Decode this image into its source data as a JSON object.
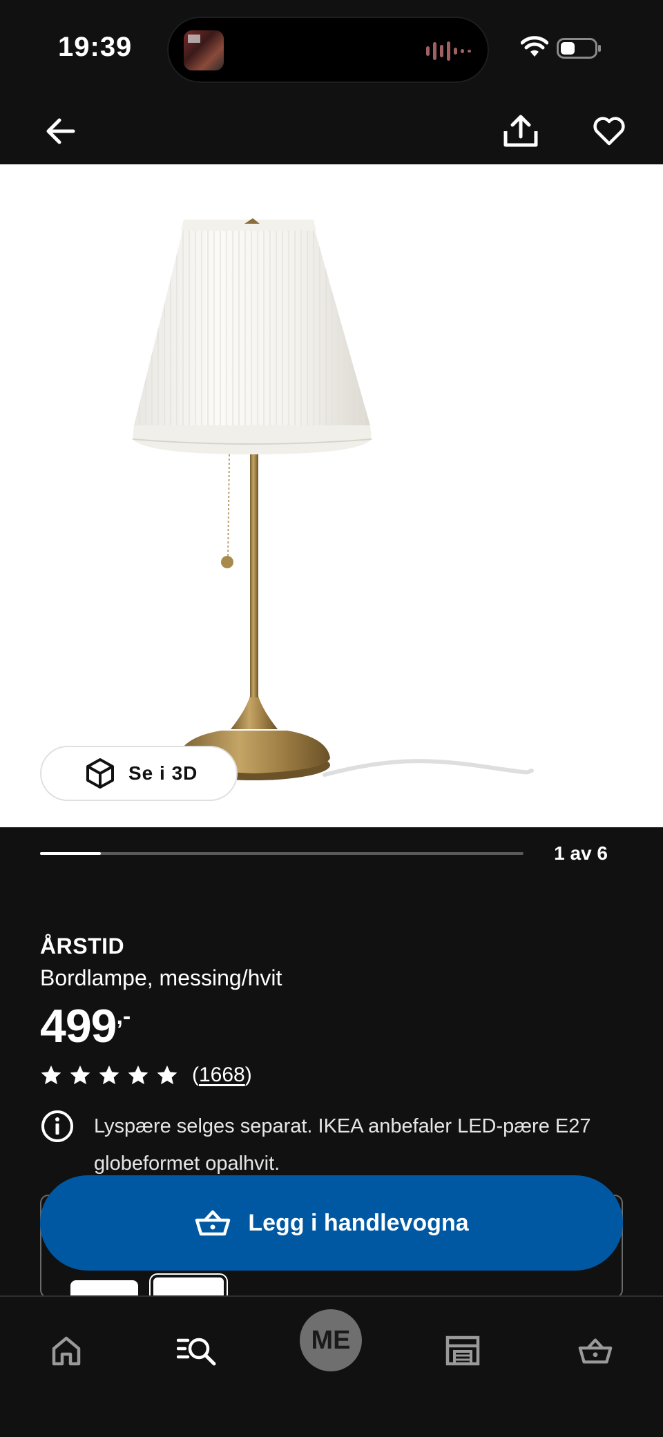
{
  "status_bar": {
    "time": "19:39"
  },
  "product": {
    "name": "ÅRSTID",
    "description": "Bordlampe, messing/hvit",
    "price_integer": "499",
    "price_decimal": ",-",
    "rating_stars": 5,
    "review_count_prefix": "(",
    "review_count": "1668",
    "review_count_suffix": ")",
    "info_text": "Lyspære selges separat. IKEA anbefaler LED-pære E27 globeformet opalhvit."
  },
  "gallery": {
    "view_3d_label": "Se i 3D",
    "counter": "1 av 6",
    "progress_fraction": 0.125
  },
  "cart_button_label": "Legg i handlevogna",
  "tab_bar": {
    "me_label": "ME"
  },
  "colors": {
    "background": "#111111",
    "accent_blue": "#0058a3",
    "brass": "#a8874a"
  },
  "icons": [
    "back-arrow-icon",
    "share-icon",
    "heart-icon",
    "cube-3d-icon",
    "star-icon",
    "info-icon",
    "basket-icon",
    "home-icon",
    "search-icon",
    "store-icon",
    "cart-icon",
    "wifi-icon",
    "battery-icon"
  ]
}
